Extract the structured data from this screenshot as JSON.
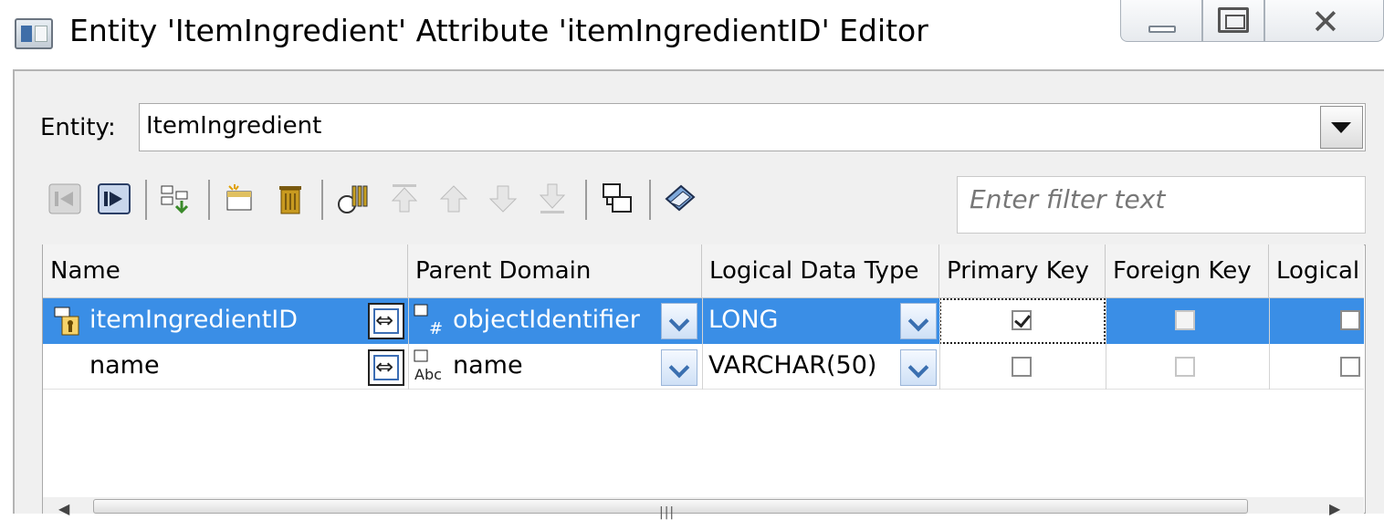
{
  "window": {
    "title": "Entity 'ItemIngredient' Attribute 'itemIngredientID' Editor"
  },
  "entity": {
    "label": "Entity:",
    "value": "ItemIngredient"
  },
  "toolbar": {
    "icons": [
      "previous-disabled-icon",
      "next-icon",
      "hierarchy-icon",
      "new-attribute-icon",
      "delete-icon",
      "reorder-icon",
      "move-top-icon",
      "move-up-icon",
      "move-down-icon",
      "move-bottom-icon",
      "copy-attributes-icon",
      "properties-icon"
    ]
  },
  "filter": {
    "placeholder": "Enter filter text"
  },
  "table": {
    "columns": [
      "Name",
      "Parent Domain",
      "Logical Data Type",
      "Primary Key",
      "Foreign Key",
      "Logical"
    ],
    "rows": [
      {
        "name": "itemIngredientID",
        "parent_domain": "objectIdentifier",
        "logical_data_type": "LONG",
        "primary_key": true,
        "foreign_key": false,
        "logical": false,
        "selected": true
      },
      {
        "name": "name",
        "parent_domain": "name",
        "logical_data_type": "VARCHAR(50)",
        "primary_key": false,
        "foreign_key": false,
        "logical": false,
        "selected": false
      }
    ]
  },
  "scrollbar": {
    "grip": "|||"
  }
}
